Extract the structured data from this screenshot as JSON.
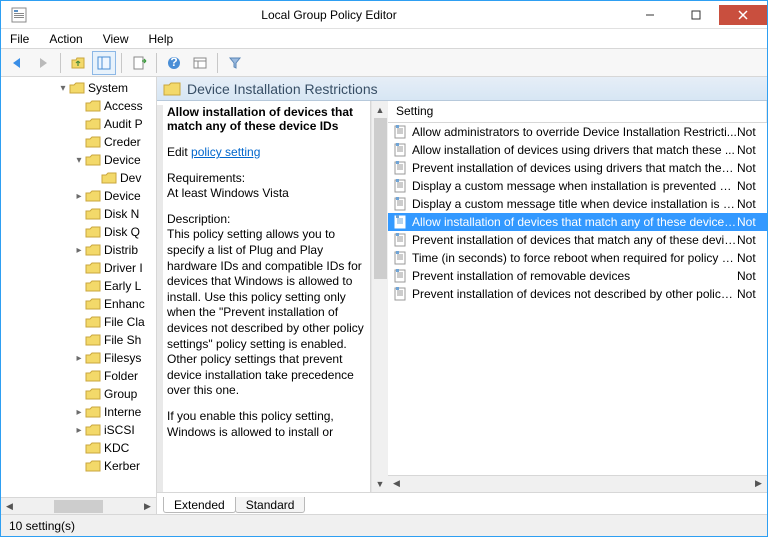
{
  "window": {
    "title": "Local Group Policy Editor"
  },
  "menu": [
    "File",
    "Action",
    "View",
    "Help"
  ],
  "tree": [
    {
      "indent": 56,
      "exp": "▾",
      "label": "System"
    },
    {
      "indent": 72,
      "exp": "",
      "label": "Access"
    },
    {
      "indent": 72,
      "exp": "",
      "label": "Audit P"
    },
    {
      "indent": 72,
      "exp": "",
      "label": "Creder"
    },
    {
      "indent": 72,
      "exp": "▾",
      "label": "Device"
    },
    {
      "indent": 88,
      "exp": "",
      "label": "Dev"
    },
    {
      "indent": 72,
      "exp": "▸",
      "label": "Device"
    },
    {
      "indent": 72,
      "exp": "",
      "label": "Disk N"
    },
    {
      "indent": 72,
      "exp": "",
      "label": "Disk Q"
    },
    {
      "indent": 72,
      "exp": "▸",
      "label": "Distrib"
    },
    {
      "indent": 72,
      "exp": "",
      "label": "Driver I"
    },
    {
      "indent": 72,
      "exp": "",
      "label": "Early L"
    },
    {
      "indent": 72,
      "exp": "",
      "label": "Enhanc"
    },
    {
      "indent": 72,
      "exp": "",
      "label": "File Cla"
    },
    {
      "indent": 72,
      "exp": "",
      "label": "File Sh"
    },
    {
      "indent": 72,
      "exp": "▸",
      "label": "Filesys"
    },
    {
      "indent": 72,
      "exp": "",
      "label": "Folder"
    },
    {
      "indent": 72,
      "exp": "",
      "label": "Group"
    },
    {
      "indent": 72,
      "exp": "▸",
      "label": "Interne"
    },
    {
      "indent": 72,
      "exp": "▸",
      "label": "iSCSI"
    },
    {
      "indent": 72,
      "exp": "",
      "label": "KDC"
    },
    {
      "indent": 72,
      "exp": "",
      "label": "Kerber"
    }
  ],
  "pane": {
    "title": "Device Installation Restrictions"
  },
  "desc": {
    "heading": "Allow installation of devices that match any of these device IDs",
    "edit_prefix": "Edit ",
    "edit_link": "policy setting ",
    "req_label": "Requirements:",
    "req_value": "At least Windows Vista",
    "desc_label": "Description:",
    "desc_body": "This policy setting allows you to specify a list of Plug and Play hardware IDs and compatible IDs for devices that Windows is allowed to install. Use this policy setting only when the \"Prevent installation of devices not described by other policy settings\" policy setting is enabled. Other policy settings that prevent device installation take precedence over this one.",
    "extra": "If you enable this policy setting, Windows is allowed to install or"
  },
  "list": {
    "col_setting": "Setting",
    "rows": [
      {
        "text": "Allow administrators to override Device Installation Restricti...",
        "state": "Not"
      },
      {
        "text": "Allow installation of devices using drivers that match these ...",
        "state": "Not"
      },
      {
        "text": "Prevent installation of devices using drivers that match thes...",
        "state": "Not"
      },
      {
        "text": "Display a custom message when installation is prevented by...",
        "state": "Not"
      },
      {
        "text": "Display a custom message title when device installation is pr...",
        "state": "Not"
      },
      {
        "text": "Allow installation of devices that match any of these device ...",
        "state": "Not",
        "selected": true
      },
      {
        "text": "Prevent installation of devices that match any of these devic...",
        "state": "Not"
      },
      {
        "text": "Time (in seconds) to force reboot when required for policy c...",
        "state": "Not"
      },
      {
        "text": "Prevent installation of removable devices",
        "state": "Not"
      },
      {
        "text": "Prevent installation of devices not described by other policy ...",
        "state": "Not"
      }
    ]
  },
  "tabs": {
    "extended": "Extended",
    "standard": "Standard"
  },
  "status": "10 setting(s)"
}
